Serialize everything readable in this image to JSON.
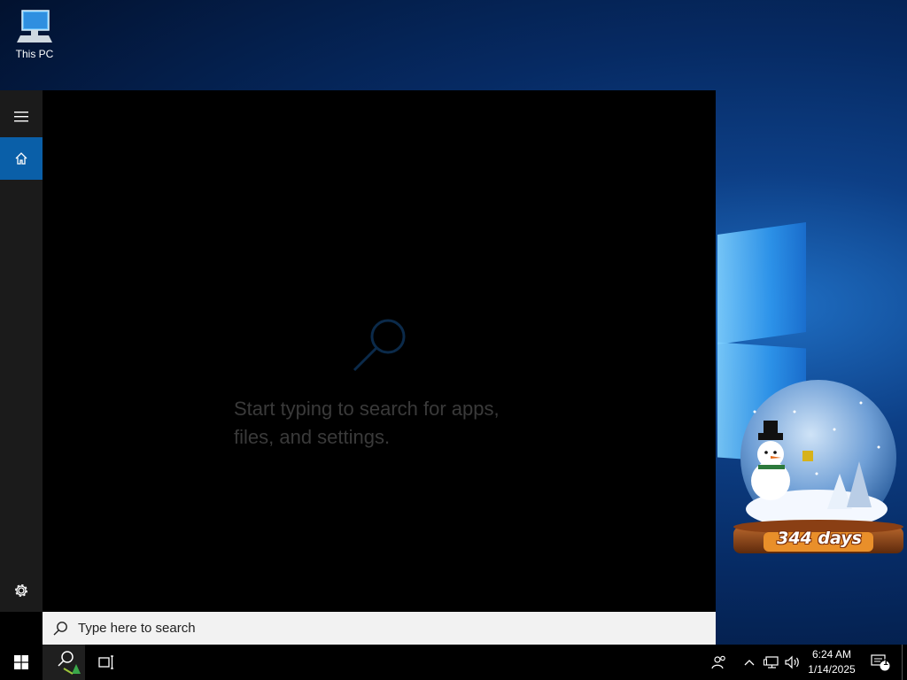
{
  "desktop": {
    "icons": [
      {
        "label": "This PC",
        "icon": "computer-icon"
      }
    ]
  },
  "search_panel": {
    "nav": [
      {
        "name": "menu",
        "icon": "hamburger-icon"
      },
      {
        "name": "home",
        "icon": "home-icon",
        "active": true
      },
      {
        "name": "settings",
        "icon": "gear-icon"
      }
    ],
    "hint_line1": "Start typing to search for apps,",
    "hint_line2": "files, and settings.",
    "search_placeholder": "Type here to search",
    "search_value": ""
  },
  "widget": {
    "days_label": "344 days"
  },
  "taskbar": {
    "buttons": [
      "start-icon",
      "search-icon",
      "task-view-icon"
    ],
    "tray": [
      "people-icon",
      "chevron-up-icon",
      "network-icon",
      "volume-icon"
    ],
    "time": "6:24 AM",
    "date": "1/14/2025",
    "notification_count": "1"
  },
  "colors": {
    "accent": "#0a5fa8",
    "panel_bg": "#000000",
    "rail_bg": "#1b1b1b"
  }
}
